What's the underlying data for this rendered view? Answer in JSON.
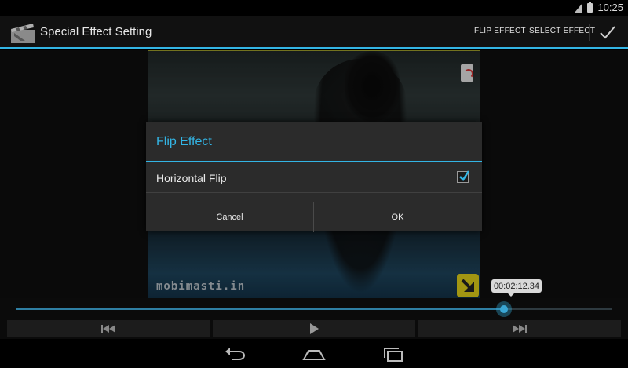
{
  "status_bar": {
    "time": "10:25",
    "icons": [
      "signal-icon",
      "battery-icon"
    ]
  },
  "action_bar": {
    "title": "Special Effect Setting",
    "app_icon": "clapperboard-icon",
    "actions": {
      "flip_effect": "FLIP EFFECT",
      "select_effect": "SELECT EFFECT"
    },
    "done_icon": "checkmark-icon",
    "accent_color": "#33b5e5"
  },
  "video": {
    "watermark": "mobimasti.in"
  },
  "dialog": {
    "title": "Flip Effect",
    "option_label": "Horizontal Flip",
    "option_checked": true,
    "cancel_label": "Cancel",
    "ok_label": "OK"
  },
  "player": {
    "current_time": "00:02:12.34",
    "progress_fraction": 0.818,
    "controls": [
      "previous-icon",
      "play-icon",
      "next-icon"
    ]
  },
  "nav_bar": {
    "buttons": [
      "back-icon",
      "home-icon",
      "recent-apps-icon"
    ]
  }
}
